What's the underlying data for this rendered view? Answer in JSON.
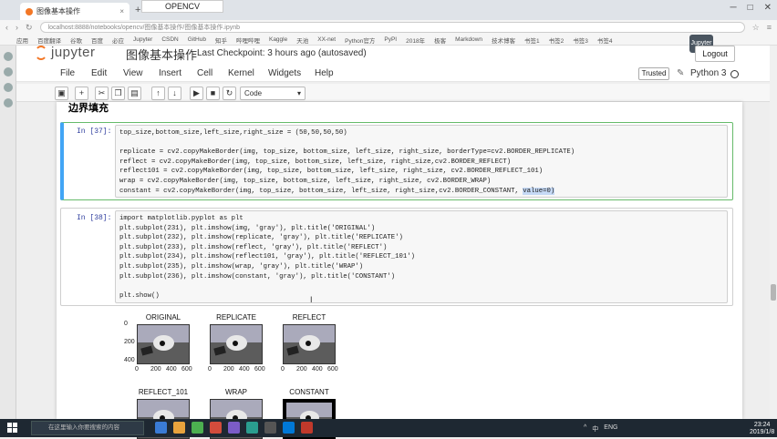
{
  "browser": {
    "tab_title": "图像基本操作",
    "overlay_label": "OPENCV",
    "url": "localhost:8888/notebooks/opencv/图像基本操作/图像基本操作.ipynb",
    "bookmarks": [
      "应用",
      "百度翻译",
      "谷歌",
      "百度",
      "必应",
      "Jupyter",
      "CSDN",
      "GitHub",
      "知乎",
      "哔哩哔哩",
      "Kaggle",
      "天池",
      "XX-net",
      "Python官方",
      "PyPI",
      "2018年",
      "极客",
      "Markdown",
      "技术博客",
      "书签1",
      "书签2",
      "书签3",
      "书签4"
    ]
  },
  "jupyter": {
    "logo_text": "jupyter",
    "notebook_title": "图像基本操作",
    "checkpoint": "Last Checkpoint: 3 hours ago (autosaved)",
    "logout": "Logout",
    "avatar": "Jupyter",
    "menu": [
      "File",
      "Edit",
      "View",
      "Insert",
      "Cell",
      "Kernel",
      "Widgets",
      "Help"
    ],
    "trusted": "Trusted",
    "kernel": "Python 3",
    "cell_type": "Code",
    "toolbar_icons": [
      "save-icon",
      "add-cell-icon",
      "cut-icon",
      "copy-icon",
      "paste-icon",
      "move-up-icon",
      "move-down-icon",
      "run-icon",
      "stop-icon",
      "restart-icon"
    ]
  },
  "heading_fragment": "边界填充",
  "cells": [
    {
      "prompt": "In [37]:",
      "lines": [
        "top_size,bottom_size,left_size,right_size = (50,50,50,50)",
        "",
        "replicate = cv2.copyMakeBorder(img, top_size, bottom_size, left_size, right_size, borderType=cv2.BORDER_REPLICATE)",
        "reflect = cv2.copyMakeBorder(img, top_size, bottom_size, left_size, right_size,cv2.BORDER_REFLECT)",
        "reflect101 = cv2.copyMakeBorder(img, top_size, bottom_size, left_size, right_size, cv2.BORDER_REFLECT_101)",
        "wrap = cv2.copyMakeBorder(img, top_size, bottom_size, left_size, right_size, cv2.BORDER_WRAP)",
        "constant = cv2.copyMakeBorder(img, top_size, bottom_size, left_size, right_size,cv2.BORDER_CONSTANT, "
      ],
      "highlight": "value=0)"
    },
    {
      "prompt": "In [38]:",
      "lines": [
        "import matplotlib.pyplot as plt",
        "plt.subplot(231), plt.imshow(img, 'gray'), plt.title('ORIGINAL')",
        "plt.subplot(232), plt.imshow(replicate, 'gray'), plt.title('REPLICATE')",
        "plt.subplot(233), plt.imshow(reflect, 'gray'), plt.title('REFLECT')",
        "plt.subplot(234), plt.imshow(reflect101, 'gray'), plt.title('REFLECT_101')",
        "plt.subplot(235), plt.imshow(wrap, 'gray'), plt.title('WRAP')",
        "plt.subplot(236), plt.imshow(constant, 'gray'), plt.title('CONSTANT')",
        "",
        "plt.show()"
      ]
    }
  ],
  "output": {
    "titles": [
      "ORIGINAL",
      "REPLICATE",
      "REFLECT",
      "REFLECT_101",
      "WRAP",
      "CONSTANT"
    ],
    "y_ticks": [
      "0",
      "200",
      "400"
    ],
    "x_ticks": [
      "0",
      "200",
      "400",
      "600"
    ]
  },
  "taskbar": {
    "search_placeholder": "在这里输入你要搜索的内容",
    "tray": [
      "^",
      "中",
      "ENG"
    ],
    "time": "23:24",
    "date": "2019/1/8"
  }
}
